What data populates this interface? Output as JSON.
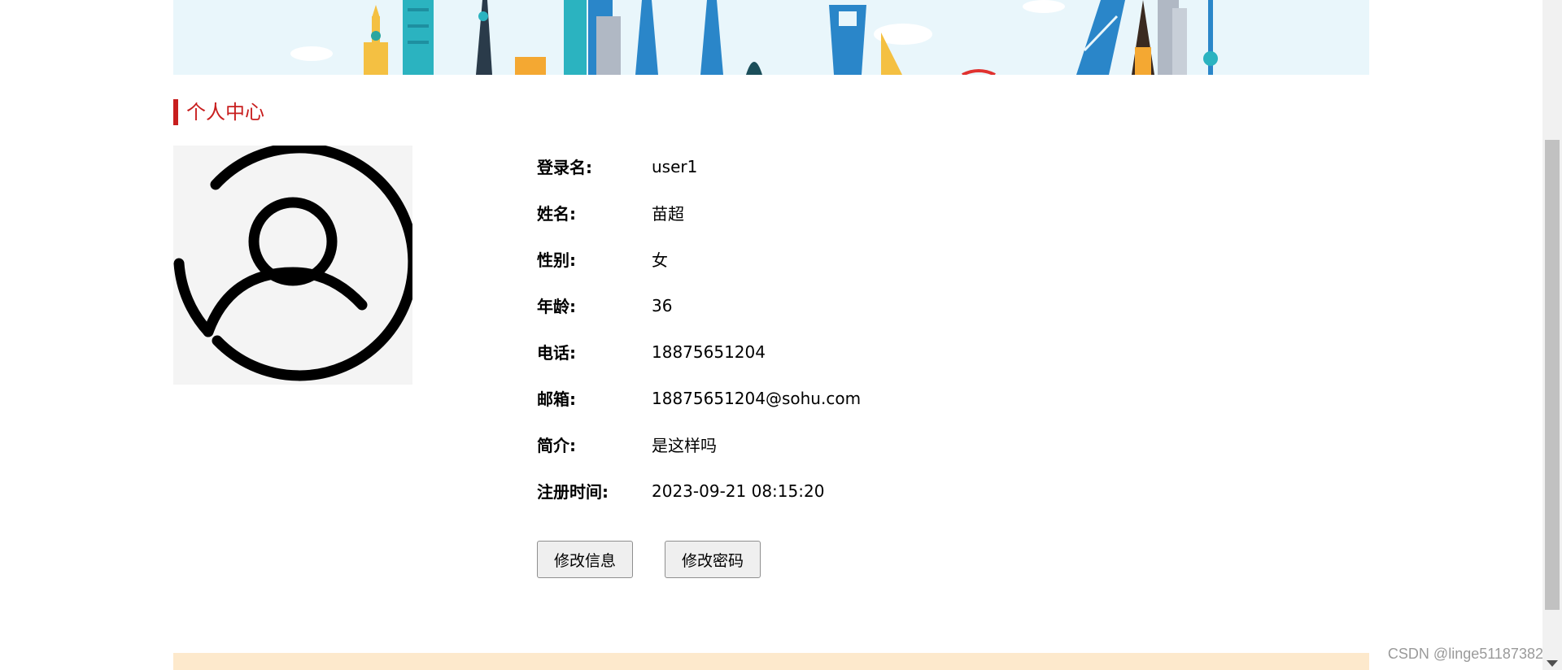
{
  "section": {
    "title": "个人中心"
  },
  "avatar": {
    "icon": "user-circle-icon"
  },
  "profile": [
    {
      "label": "登录名:",
      "value": "user1"
    },
    {
      "label": "姓名:",
      "value": "苗超"
    },
    {
      "label": "性别:",
      "value": "女"
    },
    {
      "label": "年龄:",
      "value": "36"
    },
    {
      "label": "电话:",
      "value": "18875651204"
    },
    {
      "label": "邮箱:",
      "value": "18875651204@sohu.com"
    },
    {
      "label": "简介:",
      "value": "是这样吗"
    },
    {
      "label": "注册时间:",
      "value": "2023-09-21 08:15:20"
    }
  ],
  "actions": {
    "edit_info": "修改信息",
    "change_password": "修改密码"
  },
  "watermark": "CSDN @linge511873822",
  "colors": {
    "accent": "#c81e1e",
    "banner_sky": "#e9f6fb",
    "footer": "#fde9cc"
  }
}
